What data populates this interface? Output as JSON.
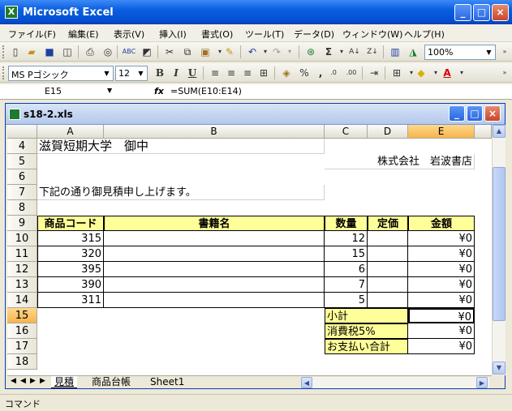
{
  "app": {
    "icon": "excel-icon",
    "title": "Microsoft Excel"
  },
  "menu": [
    "ファイル(F)",
    "編集(E)",
    "表示(V)",
    "挿入(I)",
    "書式(O)",
    "ツール(T)",
    "データ(D)",
    "ウィンドウ(W)",
    "ヘルプ(H)"
  ],
  "toolbar": {
    "zoom": "100%",
    "font_name": "MS Pゴシック",
    "font_size": "12"
  },
  "formula_bar": {
    "cell_ref": "E15",
    "fx_label": "fx",
    "formula": "=SUM(E10:E14)"
  },
  "workbook": {
    "filename": "s18-2.xls"
  },
  "columns": [
    "A",
    "B",
    "C",
    "D",
    "E"
  ],
  "selected_column": "E",
  "rows": [
    "4",
    "5",
    "6",
    "7",
    "8",
    "9",
    "10",
    "11",
    "12",
    "13",
    "14",
    "15",
    "16",
    "17",
    "18"
  ],
  "selected_row": "15",
  "sheet": {
    "addressee": "滋賀短期大学　御中",
    "company": "株式会社　岩波書店",
    "intro": "下記の通り御見積申し上げます。",
    "headers": {
      "code": "商品コード",
      "title": "書籍名",
      "qty": "数量",
      "price": "定価",
      "amount": "金額"
    },
    "items": [
      {
        "code": "315",
        "qty": "12",
        "amount": "¥0"
      },
      {
        "code": "320",
        "qty": "15",
        "amount": "¥0"
      },
      {
        "code": "395",
        "qty": "6",
        "amount": "¥0"
      },
      {
        "code": "390",
        "qty": "7",
        "amount": "¥0"
      },
      {
        "code": "311",
        "qty": "5",
        "amount": "¥0"
      }
    ],
    "subtotal_label": "小計",
    "subtotal": "¥0",
    "tax_label": "消費税5%",
    "tax": "¥0",
    "total_label": "お支払い合計",
    "total": "¥0"
  },
  "tabs": [
    "見積",
    "商品台帳",
    "Sheet1"
  ],
  "active_tab": "見積",
  "status": "コマンド",
  "colors": {
    "header_fill": "#ffff99",
    "selection": "#f5b44c",
    "titlebar": "#0a5ee0"
  }
}
